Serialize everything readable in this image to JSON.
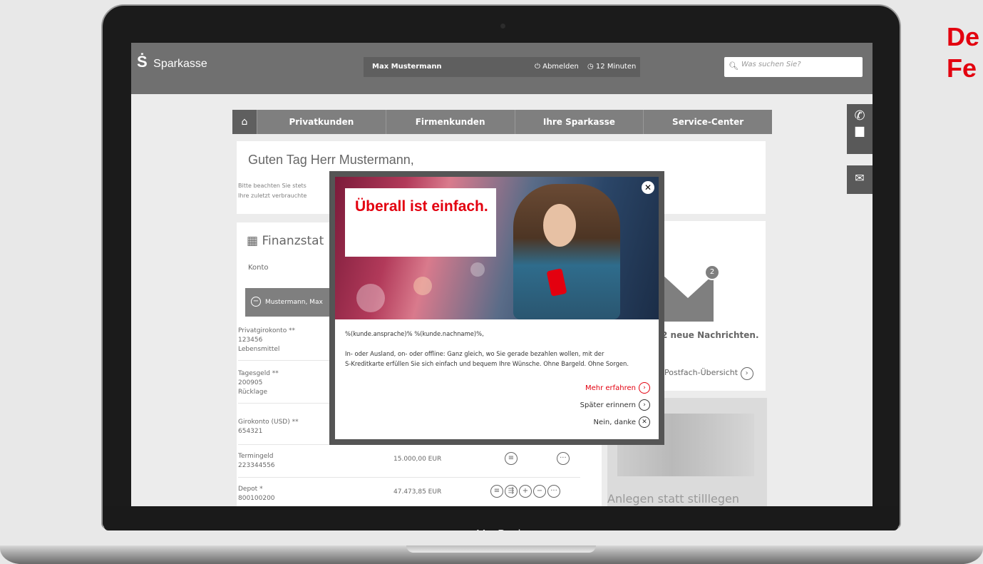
{
  "side_text": "De\nFe",
  "laptop": {
    "brand": "MacBook"
  },
  "topbar": {
    "logo_mark": "Ṡ",
    "logo_text": "Sparkasse",
    "user_name": "Max Mustermann",
    "logout_label": "Abmelden",
    "timer_label": "12 Minuten",
    "search_placeholder": "Was suchen Sie?"
  },
  "nav": {
    "home_icon": "home-icon",
    "items": [
      "Privatkunden",
      "Firmenkunden",
      "Ihre Sparkasse",
      "Service-Center"
    ]
  },
  "greeting": {
    "title": "Guten Tag Herr Mustermann,",
    "line1": "Bitte beachten Sie stets",
    "line2": "Ihre zuletzt verbrauchte"
  },
  "finance": {
    "title": "Finanzstat",
    "konto_label": "Konto",
    "group_label": "Mustermann, Max",
    "accounts": [
      {
        "lines": [
          "Privatgirokonto **",
          "123456",
          "Lebensmittel"
        ],
        "amount": "",
        "buttons": []
      },
      {
        "lines": [
          "Tagesgeld **",
          "200905",
          "Rücklage"
        ],
        "amount": "",
        "buttons": []
      },
      {
        "lines": [
          "Girokonto (USD) **",
          "654321"
        ],
        "amount": "",
        "buttons": []
      },
      {
        "lines": [
          "Termingeld",
          "223344556"
        ],
        "amount": "15.000,00 EUR",
        "buttons": [
          "≡",
          "···"
        ]
      },
      {
        "lines": [
          "Depot *",
          "800100200"
        ],
        "amount": "47.473,85 EUR",
        "buttons": [
          "≡",
          "⇶",
          "+",
          "−",
          "···"
        ]
      }
    ]
  },
  "messages": {
    "badge": "2",
    "text": "2 neue Nachrichten.",
    "postfach": "Postfach-Übersicht"
  },
  "promo": {
    "text": "Anlegen statt stilllegen"
  },
  "modal": {
    "headline": "Überall ist einfach.",
    "salutation": "%(kunde.ansprache)% %(kunde.nachname)%,",
    "body_line1": "In- oder Ausland, on- oder offline: Ganz gleich, wo Sie gerade bezahlen wollen, mit der",
    "body_line2": "S-Kreditkarte erfüllen Sie sich einfach und bequem Ihre Wünsche. Ohne Bargeld. Ohne Sorgen.",
    "action_more": "Mehr erfahren",
    "action_later": "Später erinnern",
    "action_no": "Nein, danke",
    "accent_color": "#e3000f"
  }
}
